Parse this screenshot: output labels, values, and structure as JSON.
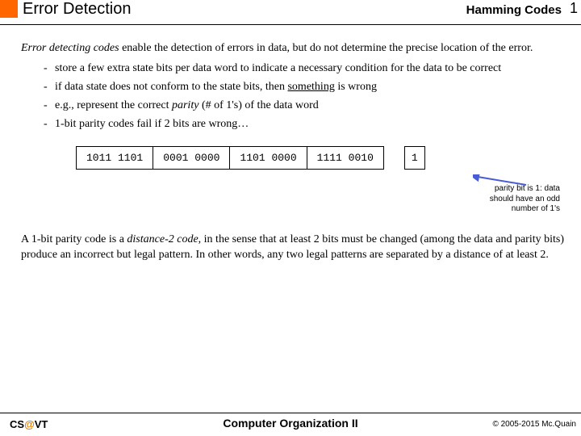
{
  "header": {
    "title_left": "Error Detection",
    "title_right": "Hamming Codes",
    "page_num": "1"
  },
  "intro": {
    "lead_italic": "Error detecting codes",
    "lead_rest": " enable the detection of errors in data, but do not determine the precise location of the error."
  },
  "bullets": [
    "store a few extra state bits per data word to indicate a necessary condition for the data to be correct",
    {
      "pre": "if data state does not conform to the state bits, then ",
      "under": "something",
      "post": " is wrong"
    },
    {
      "pre": "e.g., represent the correct ",
      "ital": "parity",
      "post": " (# of 1's) of the data word"
    },
    "1-bit parity codes fail if 2 bits are wrong…"
  ],
  "codes": {
    "c1": "1011 1101",
    "c2": "0001 0000",
    "c3": "1101 0000",
    "c4": "1111 0010",
    "parity": "1"
  },
  "annotation": "parity bit is 1: data should have an odd number of 1's",
  "closing": {
    "pre": "A 1-bit parity code is a ",
    "ital": "distance-2 code",
    "post": ", in the sense that at least 2 bits must be changed (among the data and parity bits) produce an incorrect but legal pattern.  In other words, any two legal patterns are separated by a distance of at least 2."
  },
  "footer": {
    "left_pre": "CS",
    "left_at": "@",
    "left_post": "VT",
    "center": "Computer Organization II",
    "right": "© 2005-2015 Mc.Quain"
  }
}
